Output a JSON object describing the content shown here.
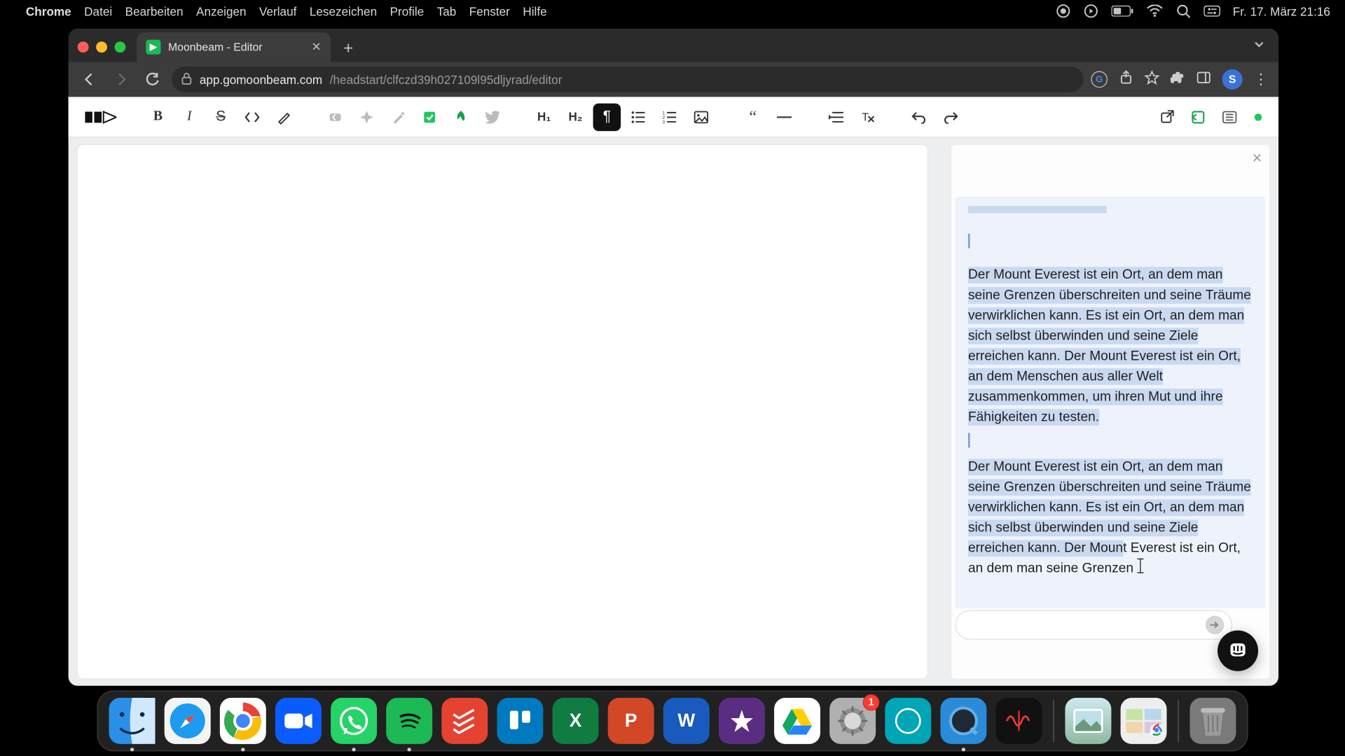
{
  "menubar": {
    "app_name": "Chrome",
    "items": [
      "Datei",
      "Bearbeiten",
      "Anzeigen",
      "Verlauf",
      "Lesezeichen",
      "Profile",
      "Tab",
      "Fenster",
      "Hilfe"
    ],
    "clock": "Fr. 17. März  21:16"
  },
  "browser": {
    "tab_title": "Moonbeam - Editor",
    "url_host": "app.gomoonbeam.com",
    "url_path": "/headstart/clfczd39h027109l95dljyrad/editor",
    "profile_initial": "S",
    "google_hint": "G"
  },
  "toolbar": {
    "bold": "B",
    "italic": "I",
    "strike": "S",
    "h1": "H₁",
    "h2": "H₂"
  },
  "panel": {
    "para1": "Der Mount Everest ist ein Ort, an dem man seine Grenzen überschreiten und seine Träume verwirklichen kann. Es ist ein Ort, an dem man sich selbst überwinden und seine Ziele erreichen kann. Der Mount Everest ist ein Ort, an dem Menschen aus aller Welt zusammenkommen, um ihren Mut und ihre Fähigkeiten zu testen.",
    "para2_hl": "Der Mount Everest ist ein Ort, an dem man seine Grenzen überschreiten und seine Träume verwirklichen kann. Es ist ein Ort, an dem man sich selbst überwinden und seine Ziele erreichen kann. Der Moun",
    "para2_plain": "t Everest ist ein Ort, an dem man seine Grenzen"
  },
  "dock": {
    "excel": "X",
    "ppt": "P",
    "word": "W",
    "settings_badge": "1"
  }
}
